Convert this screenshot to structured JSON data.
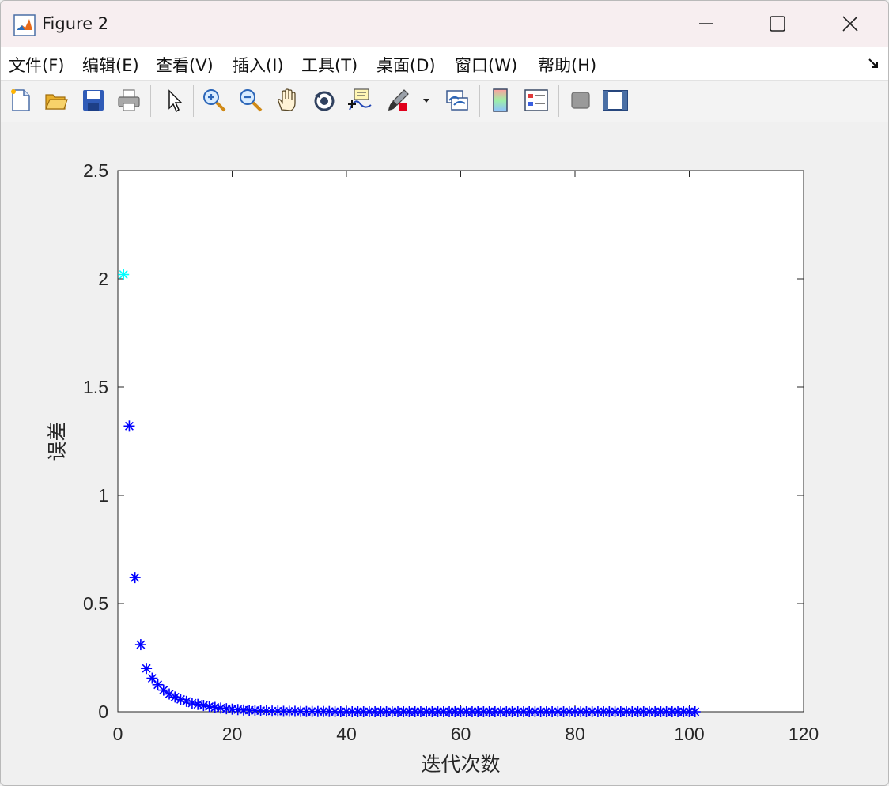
{
  "window": {
    "title": "Figure 2"
  },
  "menu": [
    {
      "label": "文件(F)"
    },
    {
      "label": "编辑(E)"
    },
    {
      "label": "查看(V)"
    },
    {
      "label": "插入(I)"
    },
    {
      "label": "工具(T)"
    },
    {
      "label": "桌面(D)"
    },
    {
      "label": "窗口(W)"
    },
    {
      "label": "帮助(H)"
    }
  ],
  "toolbar": {
    "icons": [
      "new-figure-icon",
      "open-file-icon",
      "save-icon",
      "print-icon",
      "pointer-icon",
      "zoom-in-icon",
      "zoom-out-icon",
      "pan-icon",
      "rotate-3d-icon",
      "data-cursor-icon",
      "brush-icon",
      "link-plot-icon",
      "colorbar-icon",
      "legend-icon",
      "hide-plot-tools-icon",
      "show-plot-tools-icon"
    ]
  },
  "chart_data": {
    "type": "scatter",
    "marker": "*",
    "xlabel": "迭代次数",
    "ylabel": "误差",
    "xlim": [
      0,
      120
    ],
    "ylim": [
      0,
      2.5
    ],
    "xticks": [
      0,
      20,
      40,
      60,
      80,
      100,
      120
    ],
    "yticks": [
      0,
      0.5,
      1,
      1.5,
      2,
      2.5
    ],
    "ytick_labels": [
      "0",
      "0.5",
      "1",
      "1.5",
      "2",
      "2.5"
    ],
    "grid": false,
    "colors": {
      "first_point": "#00ffff",
      "series": "#0000ff"
    },
    "series": [
      {
        "x": [
          1,
          2,
          3,
          4,
          5,
          6,
          7,
          8,
          9,
          10,
          11,
          12,
          13,
          14,
          15,
          16,
          17,
          18,
          19,
          20,
          21,
          22,
          23,
          24,
          25,
          26,
          27,
          28,
          29,
          30,
          31,
          32,
          33,
          34,
          35,
          36,
          37,
          38,
          39,
          40,
          41,
          42,
          43,
          44,
          45,
          46,
          47,
          48,
          49,
          50,
          51,
          52,
          53,
          54,
          55,
          56,
          57,
          58,
          59,
          60,
          61,
          62,
          63,
          64,
          65,
          66,
          67,
          68,
          69,
          70,
          71,
          72,
          73,
          74,
          75,
          76,
          77,
          78,
          79,
          80,
          81,
          82,
          83,
          84,
          85,
          86,
          87,
          88,
          89,
          90,
          91,
          92,
          93,
          94,
          95,
          96,
          97,
          98,
          99,
          100,
          101
        ],
        "y": [
          2.02,
          1.32,
          0.62,
          0.31,
          0.2,
          0.155,
          0.125,
          0.1,
          0.082,
          0.068,
          0.057,
          0.048,
          0.04,
          0.034,
          0.029,
          0.024,
          0.02,
          0.017,
          0.014,
          0.012,
          0.01,
          0.008,
          0.007,
          0.006,
          0.005,
          0.004,
          0.003,
          0.003,
          0.002,
          0.002,
          0.002,
          0.001,
          0.001,
          0.001,
          0.001,
          0.001,
          0.001,
          0,
          0,
          0,
          0,
          0,
          0,
          0,
          0,
          0,
          0,
          0,
          0,
          0,
          0,
          0,
          0,
          0,
          0,
          0,
          0,
          0,
          0,
          0,
          0,
          0,
          0,
          0,
          0,
          0,
          0,
          0,
          0,
          0,
          0,
          0,
          0,
          0,
          0,
          0,
          0,
          0,
          0,
          0,
          0,
          0,
          0,
          0,
          0,
          0,
          0,
          0,
          0,
          0,
          0,
          0,
          0,
          0,
          0,
          0,
          0,
          0,
          0,
          0,
          0
        ]
      }
    ]
  }
}
